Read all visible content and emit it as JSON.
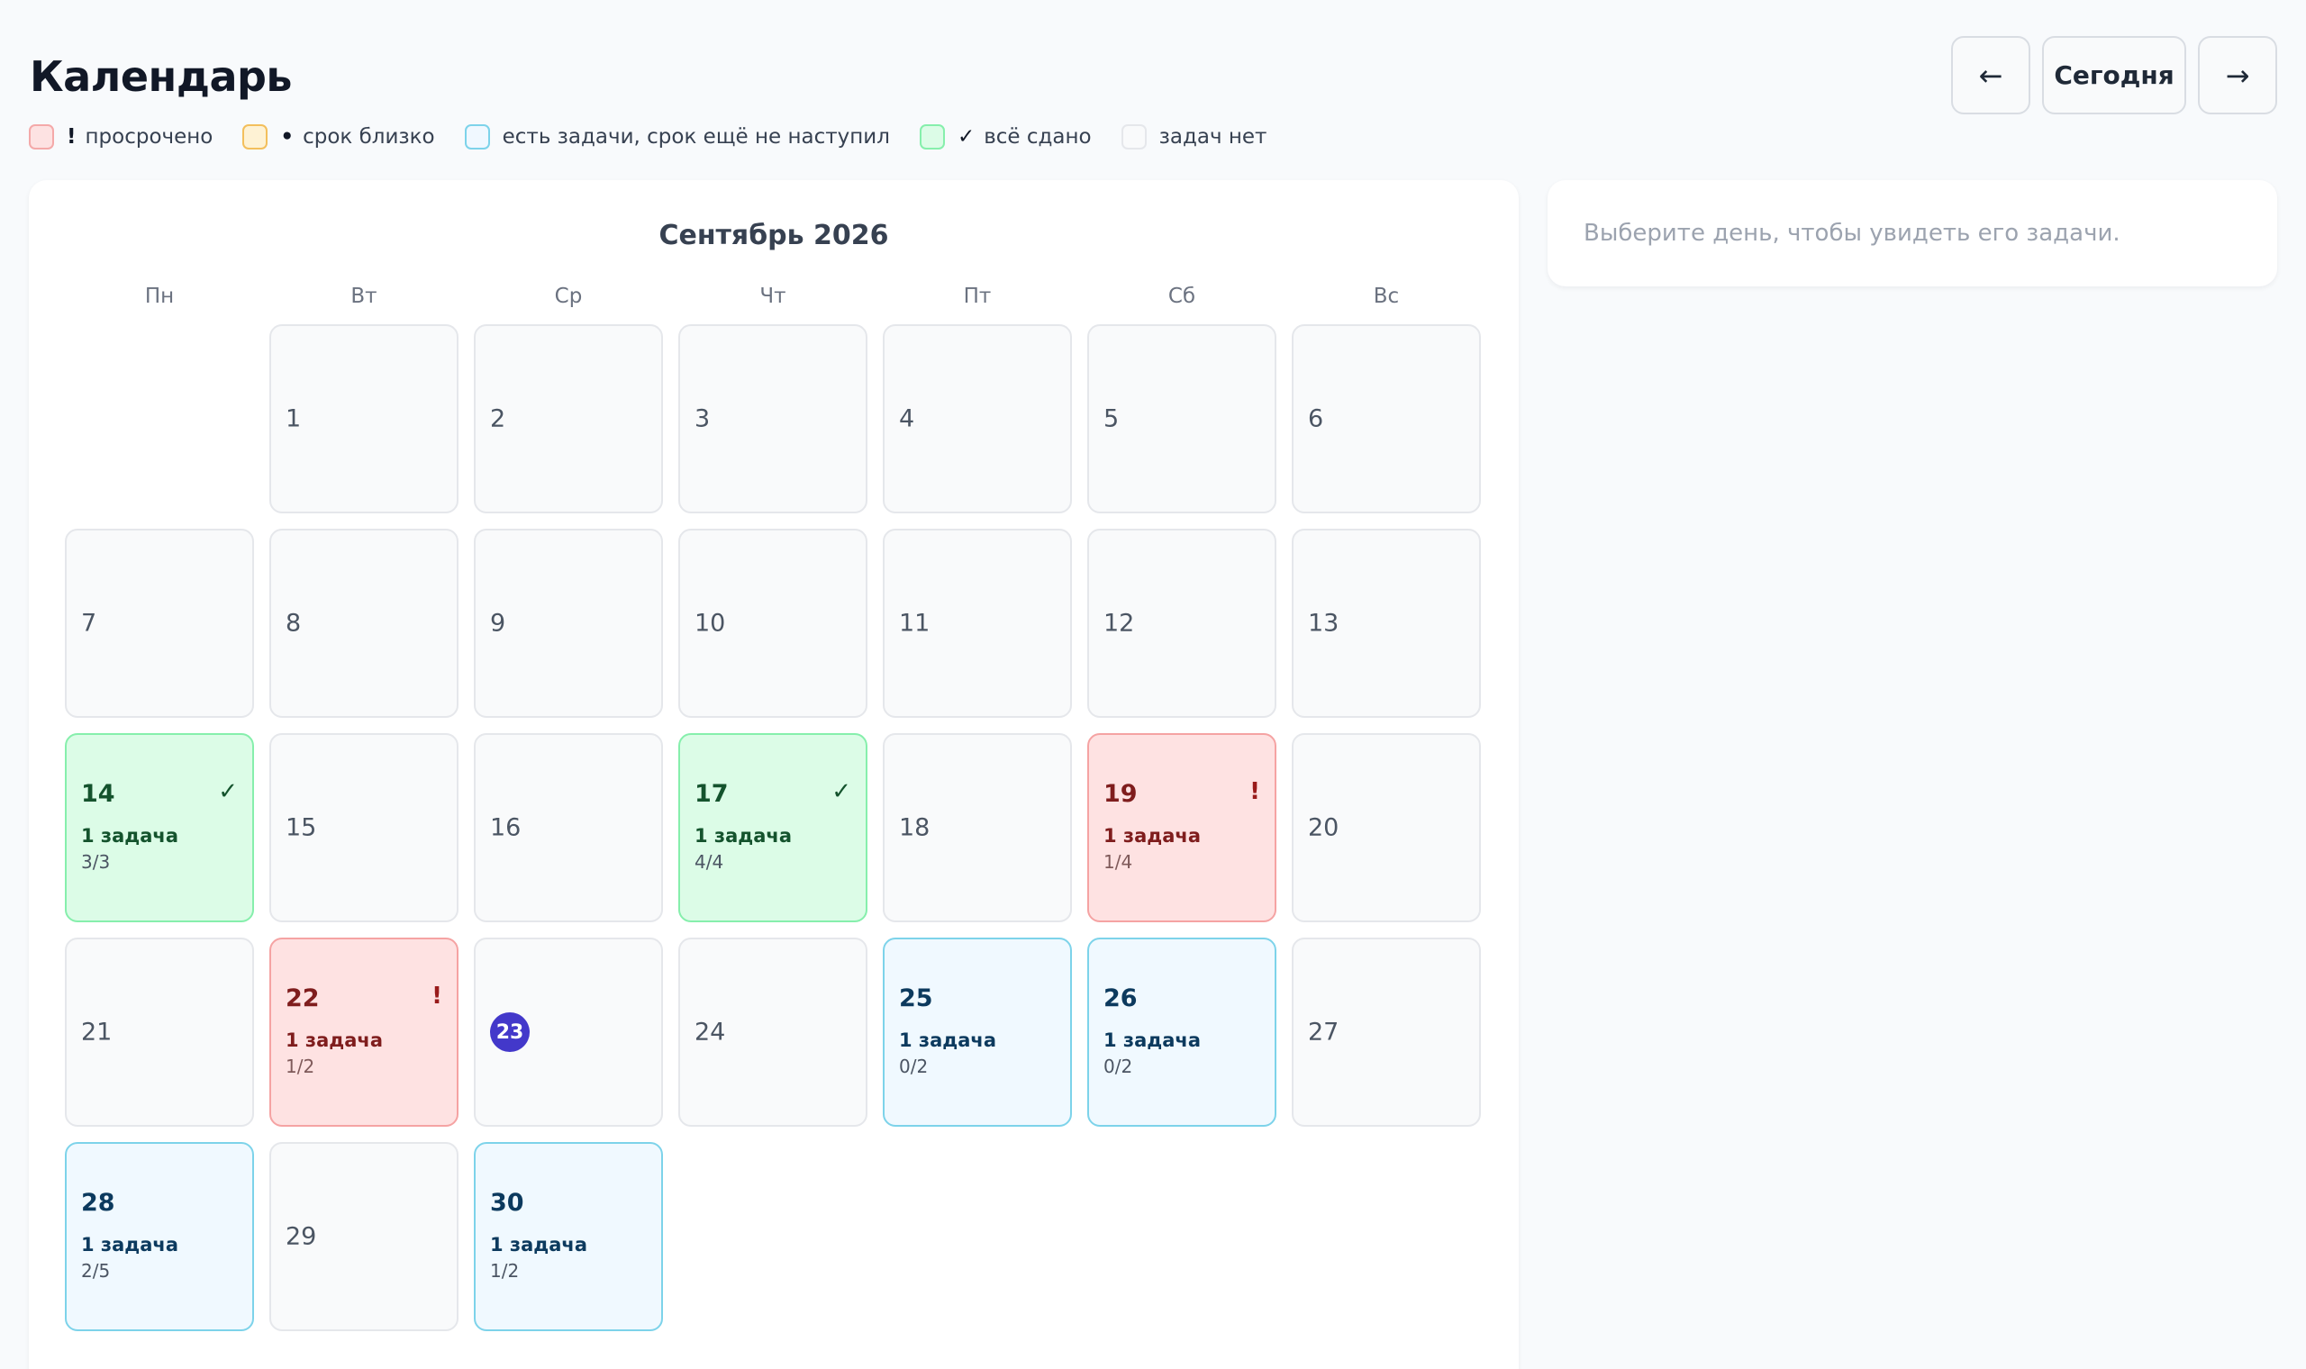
{
  "header": {
    "title": "Календарь",
    "prev_label": "←",
    "today_label": "Сегодня",
    "next_label": "→"
  },
  "legend": [
    {
      "mark": "!",
      "label": "просрочено",
      "status": "overdue"
    },
    {
      "mark": "•",
      "label": "срок близко",
      "status": "soon"
    },
    {
      "mark": "",
      "label": "есть задачи, срок ещё не наступил",
      "status": "future"
    },
    {
      "mark": "✓",
      "label": "всё сдано",
      "status": "done"
    },
    {
      "mark": "",
      "label": "задач нет",
      "status": "none"
    }
  ],
  "calendar": {
    "month_label": "Сентябрь 2026",
    "weekdays": [
      "Пн",
      "Вт",
      "Ср",
      "Чт",
      "Пт",
      "Сб",
      "Вс"
    ],
    "leading_empty": 1,
    "days": [
      {
        "day": "1"
      },
      {
        "day": "2"
      },
      {
        "day": "3"
      },
      {
        "day": "4"
      },
      {
        "day": "5"
      },
      {
        "day": "6"
      },
      {
        "day": "7"
      },
      {
        "day": "8"
      },
      {
        "day": "9"
      },
      {
        "day": "10"
      },
      {
        "day": "11"
      },
      {
        "day": "12"
      },
      {
        "day": "13"
      },
      {
        "day": "14",
        "status": "done",
        "mark": "✓",
        "tasks": "1 задача",
        "progress": "3/3"
      },
      {
        "day": "15"
      },
      {
        "day": "16"
      },
      {
        "day": "17",
        "status": "done",
        "mark": "✓",
        "tasks": "1 задача",
        "progress": "4/4"
      },
      {
        "day": "18"
      },
      {
        "day": "19",
        "status": "overdue",
        "mark": "!",
        "tasks": "1 задача",
        "progress": "1/4"
      },
      {
        "day": "20"
      },
      {
        "day": "21"
      },
      {
        "day": "22",
        "status": "overdue",
        "mark": "!",
        "tasks": "1 задача",
        "progress": "1/2"
      },
      {
        "day": "23",
        "today": true
      },
      {
        "day": "24"
      },
      {
        "day": "25",
        "status": "future",
        "tasks": "1 задача",
        "progress": "0/2"
      },
      {
        "day": "26",
        "status": "future",
        "tasks": "1 задача",
        "progress": "0/2"
      },
      {
        "day": "27"
      },
      {
        "day": "28",
        "status": "future",
        "tasks": "1 задача",
        "progress": "2/5"
      },
      {
        "day": "29"
      },
      {
        "day": "30",
        "status": "future",
        "tasks": "1 задача",
        "progress": "1/2"
      }
    ]
  },
  "side_panel": {
    "hint": "Выберите день, чтобы увидеть его задачи."
  }
}
